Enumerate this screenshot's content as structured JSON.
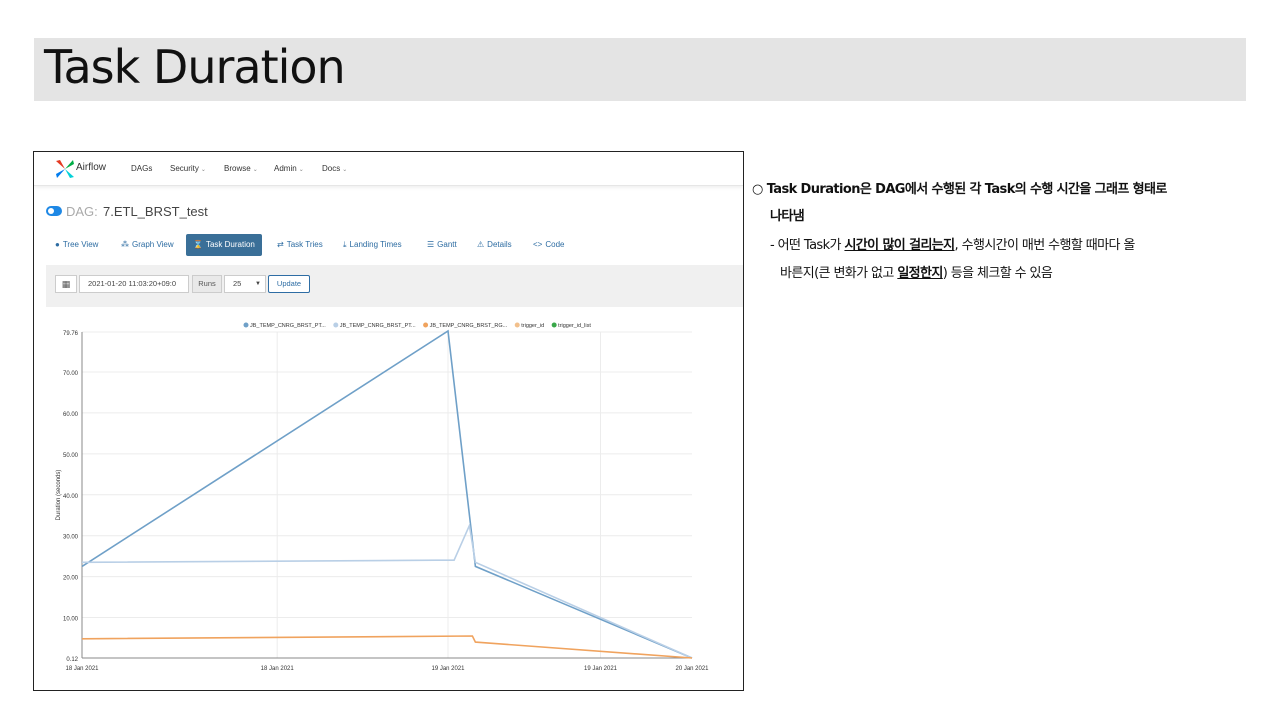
{
  "slide": {
    "title": "Task Duration"
  },
  "app": {
    "brand": "Airflow",
    "nav": [
      {
        "label": "DAGs",
        "caret": ""
      },
      {
        "label": "Security",
        "caret": "⌄"
      },
      {
        "label": "Browse",
        "caret": "⌄"
      },
      {
        "label": "Admin",
        "caret": "⌄"
      },
      {
        "label": "Docs",
        "caret": "⌄"
      }
    ],
    "dag_prefix": "DAG:",
    "dag_name": "7.ETL_BRST_test",
    "tabs": [
      {
        "label": "Tree View",
        "icon": "tree-icon",
        "glyph": "●"
      },
      {
        "label": "Graph View",
        "icon": "graph-icon",
        "glyph": "⁂"
      },
      {
        "label": "Task Duration",
        "icon": "hourglass-icon",
        "glyph": "⌛"
      },
      {
        "label": "Task Tries",
        "icon": "tries-icon",
        "glyph": "⇄"
      },
      {
        "label": "Landing Times",
        "icon": "landing-icon",
        "glyph": "⤓"
      },
      {
        "label": "Gantt",
        "icon": "gantt-icon",
        "glyph": "☰"
      },
      {
        "label": "Details",
        "icon": "warning-icon",
        "glyph": "⚠"
      },
      {
        "label": "Code",
        "icon": "code-icon",
        "glyph": "<>"
      }
    ],
    "active_tab": "Task Duration",
    "filter": {
      "date_value": "2021-01-20 11:03:20+09:0",
      "runs_label": "Runs",
      "runs_value": "25",
      "update_label": "Update"
    }
  },
  "chart_data": {
    "type": "line",
    "ylabel": "Duration (seconds)",
    "ytick_labels": [
      "0.12",
      "10.00",
      "20.00",
      "30.00",
      "40.00",
      "50.00",
      "60.00",
      "70.00",
      "79.76"
    ],
    "yticks": [
      0.12,
      10,
      20,
      30,
      40,
      50,
      60,
      70,
      79.76
    ],
    "ylim": [
      0.12,
      79.76
    ],
    "xtick_labels": [
      "18 Jan 2021",
      "18 Jan 2021",
      "19 Jan 2021",
      "19 Jan 2021",
      "20 Jan 2021"
    ],
    "xticks": [
      0,
      0.32,
      0.6,
      0.85,
      1.0
    ],
    "grid": true,
    "legend_position": "top",
    "series": [
      {
        "name": "JB_TEMP_CNRG_BRST_PT...",
        "color": "#6fa0c8",
        "points": [
          [
            0,
            22.5
          ],
          [
            0.6,
            80
          ],
          [
            0.645,
            22.5
          ],
          [
            1.0,
            0.12
          ]
        ]
      },
      {
        "name": "JB_TEMP_CNRG_BRST_PT...",
        "color": "#b9cfe6",
        "points": [
          [
            0,
            23.5
          ],
          [
            0.58,
            24
          ],
          [
            0.61,
            24
          ],
          [
            0.635,
            32.5
          ],
          [
            0.645,
            23.5
          ],
          [
            1.0,
            0.12
          ]
        ]
      },
      {
        "name": "JB_TEMP_CNRG_BRST_RG...",
        "color": "#f0a35e",
        "points": [
          [
            0,
            4.8
          ],
          [
            0.64,
            5.5
          ],
          [
            0.645,
            4
          ],
          [
            1.0,
            0.12
          ]
        ]
      },
      {
        "name": "trigger_id",
        "color": "#f2c08c",
        "points": []
      },
      {
        "name": "trigger_id_list",
        "color": "#3aa84a",
        "points": []
      }
    ]
  },
  "notes": {
    "bullet": "○",
    "head_line1": "Task Duration은 DAG에서 수행된 각 Task의 수행 시간을 그래프 형태로",
    "head_line2": "나타냄",
    "body_line1_pre": "- 어떤 Task가 ",
    "body_line1_u": "시간이 많이 걸리는지",
    "body_line1_post": ", 수행시간이 매번 수행할 때마다 올",
    "body_line2_pre": "바른지(큰 변화가 없고 ",
    "body_line2_u": "일정한지",
    "body_line2_post": ") 등을 체크할 수 있음"
  }
}
